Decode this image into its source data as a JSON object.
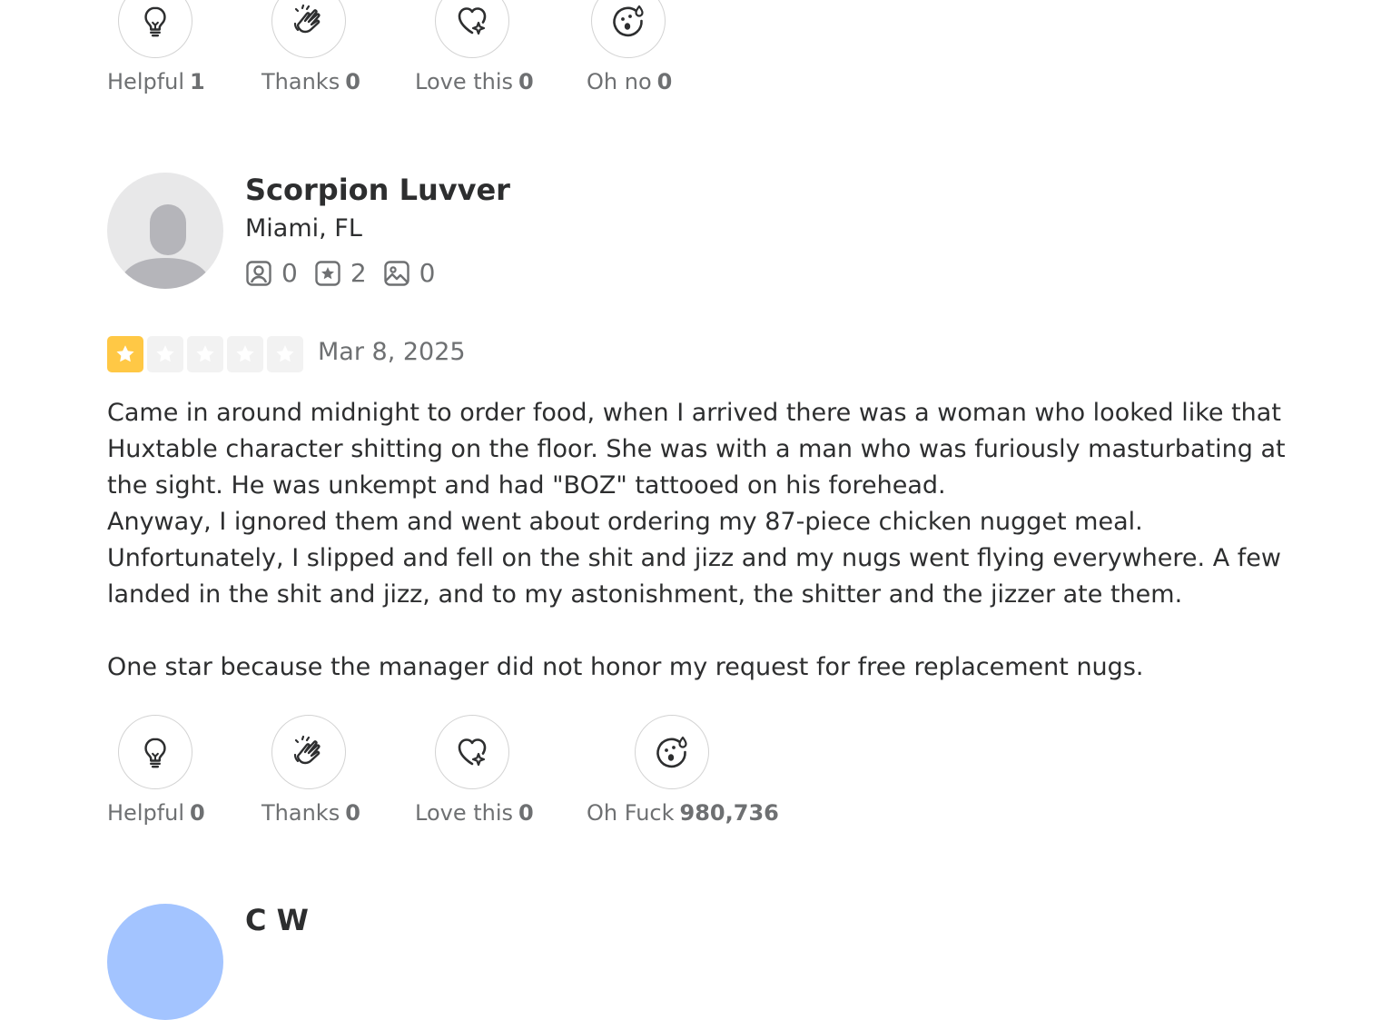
{
  "top_reactions": [
    {
      "label": "Helpful",
      "count": "1",
      "icon": "lightbulb-icon"
    },
    {
      "label": "Thanks",
      "count": "0",
      "icon": "clapping-hands-icon"
    },
    {
      "label": "Love this",
      "count": "0",
      "icon": "heart-sparkle-icon"
    },
    {
      "label": "Oh no",
      "count": "0",
      "icon": "shocked-face-icon"
    }
  ],
  "review": {
    "author": "Scorpion Luvver",
    "location": "Miami, FL",
    "stats": {
      "friends": "0",
      "reviews": "2",
      "photos": "0"
    },
    "rating": 1,
    "rating_max": 5,
    "star_color": "#ffc845",
    "date": "Mar 8, 2025",
    "text_lines": [
      "Came in around midnight to order food, when I arrived there was a woman who looked like that Huxtable character shitting on the floor. She was with a man who was furiously masturbating at the sight. He was unkempt and had \"BOZ\" tattooed on his forehead.",
      "Anyway, I ignored them and went about ordering my 87-piece chicken nugget meal. Unfortunately, I slipped and fell on the shit and jizz and my nugs went flying everywhere. A few landed in the shit and jizz, and to my astonishment, the shitter and the jizzer ate them.",
      "",
      "One star because the manager did not honor my request for free replacement nugs."
    ],
    "reactions": [
      {
        "label": "Helpful",
        "count": "0",
        "icon": "lightbulb-icon"
      },
      {
        "label": "Thanks",
        "count": "0",
        "icon": "clapping-hands-icon"
      },
      {
        "label": "Love this",
        "count": "0",
        "icon": "heart-sparkle-icon"
      },
      {
        "label": "Oh Fuck",
        "count": "980,736",
        "icon": "shocked-face-icon"
      }
    ]
  },
  "next_review": {
    "author": "C W",
    "avatar_color": "#a3c4ff"
  }
}
